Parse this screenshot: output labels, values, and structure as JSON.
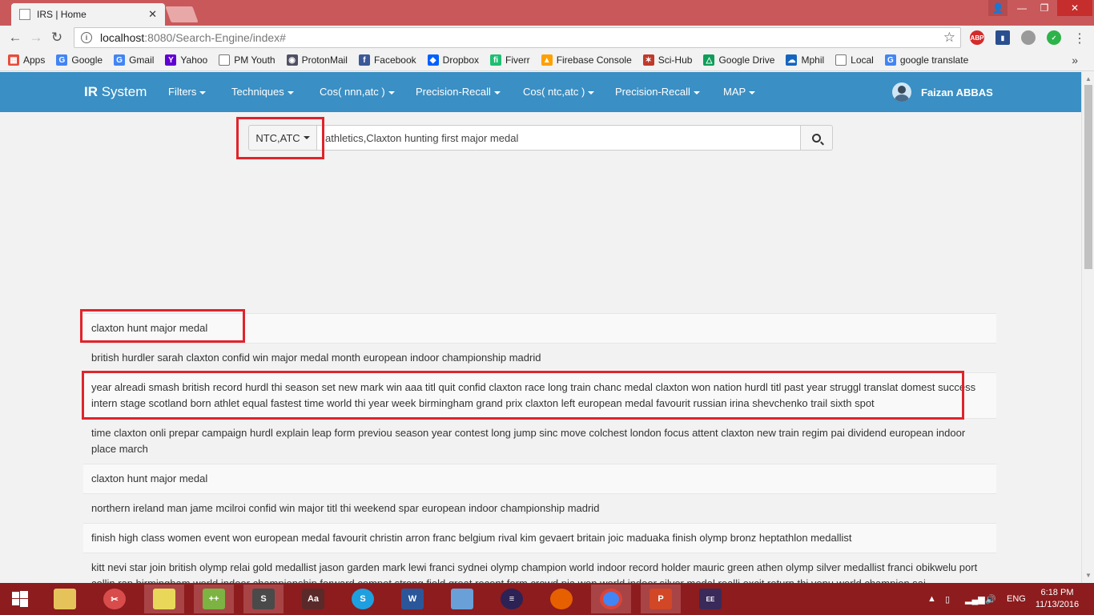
{
  "browser": {
    "tab_title": "IRS | Home",
    "tab_close": "✕",
    "url_host": "localhost",
    "url_path": ":8080/Search-Engine/index#",
    "window_buttons": {
      "user": "👤",
      "minimize": "—",
      "maximize": "❐",
      "close": "✕"
    }
  },
  "bookmarks": [
    {
      "label": "Apps",
      "icon": "apps-grid-icon"
    },
    {
      "label": "Google",
      "icon": "google-icon"
    },
    {
      "label": "Gmail",
      "icon": "google-icon"
    },
    {
      "label": "Yahoo",
      "icon": "yahoo-icon"
    },
    {
      "label": "PM Youth",
      "icon": "page-icon"
    },
    {
      "label": "ProtonMail",
      "icon": "protonmail-icon"
    },
    {
      "label": "Facebook",
      "icon": "facebook-icon"
    },
    {
      "label": "Dropbox",
      "icon": "dropbox-icon"
    },
    {
      "label": "Fiverr",
      "icon": "fiverr-icon"
    },
    {
      "label": "Firebase Console",
      "icon": "firebase-icon"
    },
    {
      "label": "Sci-Hub",
      "icon": "scihub-icon"
    },
    {
      "label": "Google Drive",
      "icon": "drive-icon"
    },
    {
      "label": "Mphil",
      "icon": "cloud-icon"
    },
    {
      "label": "Local",
      "icon": "page-icon"
    },
    {
      "label": "google translate",
      "icon": "google-icon"
    }
  ],
  "bookmarks_more": "»",
  "app": {
    "brand_bold": "IR",
    "brand_rest": " System",
    "menus": [
      "Filters",
      "Techniques",
      "Cos( nnn,atc )",
      "Precision-Recall",
      "Cos( ntc,atc )",
      "Precision-Recall",
      "MAP"
    ],
    "user_name": "Faizan ABBAS"
  },
  "search": {
    "scheme_label": "NTC,ATC",
    "query": "athletics,Claxton hunting first major medal"
  },
  "results": [
    "claxton hunt major medal",
    "british hurdler sarah claxton confid win major medal month european indoor championship madrid",
    "year alreadi smash british record hurdl thi season set new mark win aaa titl quit confid claxton race long train chanc medal claxton won nation hurdl titl past year struggl translat domest success intern stage scotland born athlet equal fastest time world thi year week birmingham grand prix claxton left european medal favourit russian irina shevchenko trail sixth spot",
    "time claxton onli prepar campaign hurdl explain leap form previou season year contest long jump sinc move colchest london focus attent claxton new train regim pai dividend european indoor place march",
    "claxton hunt major medal",
    "northern ireland man jame mcilroi confid win major titl thi weekend spar european indoor championship madrid",
    "finish high class women event won european medal favourit christin arron franc belgium rival kim gevaert britain joic maduaka finish olymp bronz heptathlon medallist",
    "kitt nevi star join british olymp relai gold medallist jason garden mark lewi franci sydnei olymp champion world indoor record holder mauric green athen olymp silver medallist franci obikwelu port collin rap birmingham world indoor championship forward compet strong field great recent form crowd pia won world indoor silver medal realli excit return thi venu world champion sai"
  ],
  "taskbar": {
    "lang": "ENG",
    "time": "6:18 PM",
    "date": "11/13/2016"
  },
  "colors": {
    "navbar": "#3a8fc4",
    "highlight": "#e0242b",
    "titlebar": "#c9585a",
    "taskbar": "#8c1c1e"
  }
}
